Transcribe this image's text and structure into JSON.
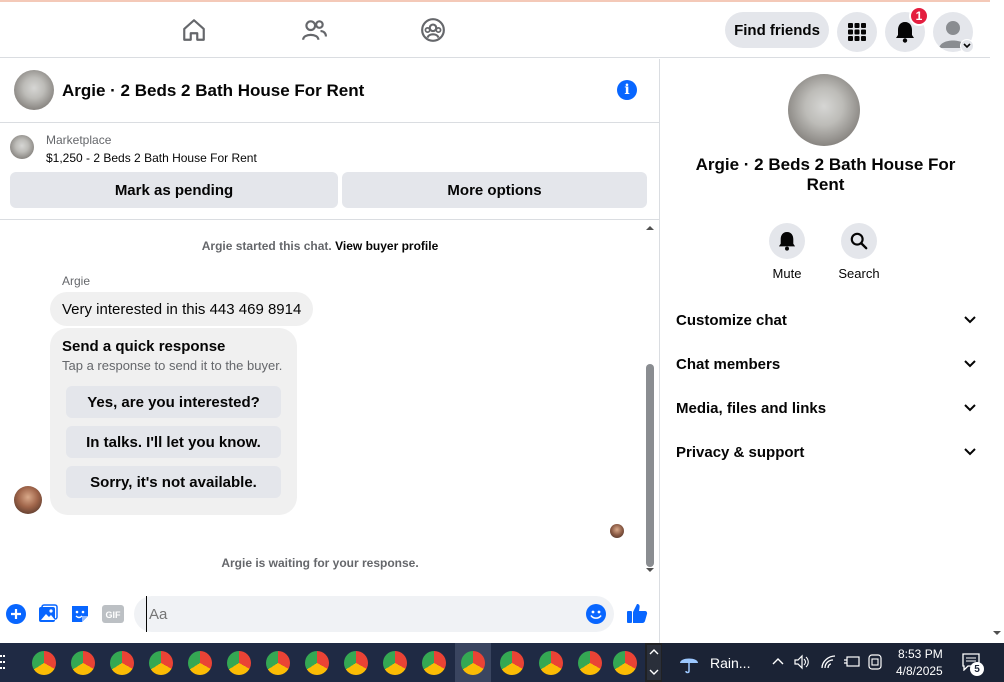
{
  "topbar": {
    "find_friends_label": "Find friends",
    "notification_count": "1"
  },
  "chat": {
    "title": "Argie · 2 Beds 2 Bath House For Rent",
    "marketplace_label": "Marketplace",
    "listing": "$1,250 - 2 Beds 2 Bath House For Rent",
    "mark_pending_label": "Mark as pending",
    "more_options_label": "More options",
    "started_text": "Argie started this chat.",
    "view_buyer_label": "View buyer profile",
    "sender_name": "Argie",
    "message": "Very interested in this  443 469 8914",
    "quick_title": "Send a quick response",
    "quick_subtitle": "Tap a response to send it to the buyer.",
    "quick_responses": [
      "Yes, are you interested?",
      "In talks. I'll let you know.",
      "Sorry, it's not available."
    ],
    "waiting_text": "Argie is waiting for your response.",
    "composer_placeholder": "Aa"
  },
  "details": {
    "title": "Argie · 2 Beds 2 Bath House For Rent",
    "mute_label": "Mute",
    "search_label": "Search",
    "sections": [
      "Customize chat",
      "Chat members",
      "Media, files and links",
      "Privacy & support"
    ]
  },
  "taskbar": {
    "weather": "Rain...",
    "time": "8:53 PM",
    "date": "4/8/2025",
    "notif_count": "5"
  },
  "colors": {
    "accent": "#0866ff",
    "badge": "#e41e3f",
    "bubble": "#f0f0f0",
    "button": "#e4e6eb"
  }
}
